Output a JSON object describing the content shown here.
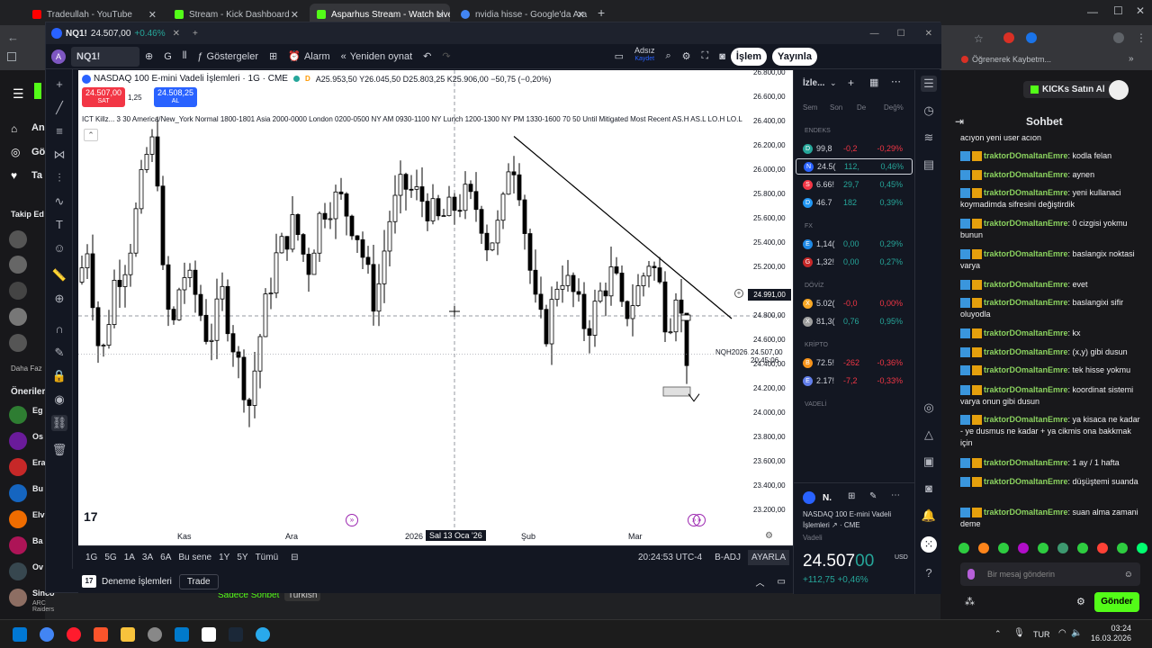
{
  "browser": {
    "tabs": [
      {
        "label": "Tradeullah - YouTube",
        "color": "#ff0000"
      },
      {
        "label": "Stream - Kick Dashboard",
        "color": "#53fc18"
      },
      {
        "label": "Asparhus Stream - Watch Live c",
        "color": "#53fc18"
      },
      {
        "label": "nvidia hisse - Google'da Ara",
        "color": "#4285f4"
      }
    ],
    "bookmark": "Öğrenerek Kaybetm..."
  },
  "tv": {
    "title": {
      "symbol": "NQ1!",
      "price": "24.507,00",
      "change": "+0.46%"
    },
    "toolbar": {
      "symbol": "NQ1!",
      "interval": "G",
      "indicators": "Göstergeler",
      "alarm": "Alarm",
      "replay": "Yeniden oynat",
      "layout_name": "Adsız",
      "layout_save": "Kaydet",
      "trade": "İşlem",
      "publish": "Yayınla"
    },
    "legend": {
      "name": "NASDAQ 100 E-mini Vadeli İşlemleri · 1G · CME",
      "ohlc": "A25.953,50  Y26.045,50  D25.803,25  K25.906,00  −50,75 (−0,20%)",
      "sell_price": "24.507,00",
      "sell_label": "SAT",
      "spread": "1,25",
      "buy_price": "24.508,25",
      "buy_label": "AL",
      "indicator": "ICT Killz... 3 30 America/New_York Normal 1800-1801 Asia 2000-0000 London 0200-0500 NY AM 0930-1100 NY Lunch 1200-1300 NY PM 1330-1600 70 50 Until Mitigated Most Recent AS.H AS.L LO.H LO.L"
    },
    "price_ticks": [
      "26.800,00",
      "26.600,00",
      "26.400,00",
      "26.200,00",
      "26.000,00",
      "25.800,00",
      "25.600,00",
      "25.400,00",
      "25.200,00",
      "24.800,00",
      "24.600,00",
      "24.400,00",
      "24.200,00",
      "24.000,00",
      "23.800,00",
      "23.600,00",
      "23.400,00",
      "23.200,00"
    ],
    "crosshair_price": "24.991,00",
    "last_price": {
      "label": "NQH2026",
      "price": "24.507,00",
      "countdown": "20:45:06"
    },
    "time_ticks": [
      "Kas",
      "Ara",
      "2026",
      "Şub",
      "Mar"
    ],
    "crosshair_date": "Sal 13 Oca '26",
    "bottom": {
      "ranges": [
        "1G",
        "5G",
        "1A",
        "3A",
        "6A",
        "Bu sene",
        "1Y",
        "5Y",
        "Tümü"
      ],
      "clock": "20:24:53 UTC-4",
      "badj": "B-ADJ",
      "settings": "AYARLA"
    },
    "trade_bar": {
      "demo": "Deneme İşlemleri",
      "trade": "Trade"
    },
    "watchlist": {
      "title": "İzle...",
      "columns": [
        "Sem",
        "Son",
        "De",
        "Değ%"
      ],
      "sections": [
        {
          "name": "ENDEKS",
          "rows": [
            {
              "sym": "D",
              "color": "#26a69a",
              "last": "99,8",
              "chg": "-0,2",
              "pct": "-0,29%",
              "dir": "down"
            },
            {
              "sym": "N",
              "color": "#2962ff",
              "last": "24.5(",
              "chg": "112,",
              "pct": "0,46%",
              "dir": "up"
            },
            {
              "sym": "S",
              "color": "#f23645",
              "last": "6.66!",
              "chg": "29,7",
              "pct": "0,45%",
              "dir": "up"
            },
            {
              "sym": "D",
              "color": "#2196f3",
              "last": "46.7",
              "chg": "182",
              "pct": "0,39%",
              "dir": "up"
            }
          ]
        },
        {
          "name": "FX",
          "rows": [
            {
              "sym": "E",
              "color": "#1e88e5",
              "last": "1,14(",
              "chg": "0,00",
              "pct": "0,29%",
              "dir": "up"
            },
            {
              "sym": "G",
              "color": "#c62828",
              "last": "1,32!",
              "chg": "0,00",
              "pct": "0,27%",
              "dir": "up"
            }
          ]
        },
        {
          "name": "DÖVİZ",
          "rows": [
            {
              "sym": "X",
              "color": "#f9a825",
              "last": "5.02(",
              "chg": "-0,0",
              "pct": "0,00%",
              "dir": "down"
            },
            {
              "sym": "X",
              "color": "#9e9e9e",
              "last": "81,3(",
              "chg": "0,76",
              "pct": "0,95%",
              "dir": "up"
            }
          ]
        },
        {
          "name": "KRİPTO",
          "rows": [
            {
              "sym": "B",
              "color": "#f7931a",
              "last": "72.5!",
              "chg": "-262",
              "pct": "-0,36%",
              "dir": "down"
            },
            {
              "sym": "E",
              "color": "#627eea",
              "last": "2.17!",
              "chg": "-7,2",
              "pct": "-0,33%",
              "dir": "down"
            }
          ]
        },
        {
          "name": "VADELİ",
          "rows": []
        }
      ],
      "detail": {
        "symbol": "N.",
        "name1": "NASDAQ 100 E-mini Vadeli",
        "name2": "İşlemleri",
        "exchange": "CME",
        "type": "Vadeli",
        "price_main": "24.507",
        "price_dec": "00",
        "currency": "USD",
        "change": "+112,75",
        "change_pct": "+0,46%"
      }
    }
  },
  "kick": {
    "buy": "KICKs Satın Al",
    "chat_title": "Sohbet",
    "first_line": "acıyon yeni user acıon",
    "messages": [
      {
        "user": "traktorDOmaltanEmre",
        "text": "kodla felan"
      },
      {
        "user": "traktorDOmaltanEmre",
        "text": "aynen"
      },
      {
        "user": "traktorDOmaltanEmre",
        "text": "yeni kullanaci koymadimda sifresini değiştirdik"
      },
      {
        "user": "traktorDOmaltanEmre",
        "text": "0 cizgisi yokmu bunun"
      },
      {
        "user": "traktorDOmaltanEmre",
        "text": "baslangix noktasi varya"
      },
      {
        "user": "traktorDOmaltanEmre",
        "text": "evet"
      },
      {
        "user": "traktorDOmaltanEmre",
        "text": "baslangixi sifir oluyodla"
      },
      {
        "user": "traktorDOmaltanEmre",
        "text": "kx"
      },
      {
        "user": "traktorDOmaltanEmre",
        "text": "(x,y) gibi dusun"
      },
      {
        "user": "traktorDOmaltanEmre",
        "text": "tek hisse yokmu"
      },
      {
        "user": "traktorDOmaltanEmre",
        "text": "koordinat sistemi varya onun gibi dusun"
      },
      {
        "user": "traktorDOmaltanEmre",
        "text": "ya kisaca ne kadar - ye dusmus ne kadar + ya cikmis ona bakkmak için"
      },
      {
        "user": "traktorDOmaltanEmre",
        "text": "1 ay / 1 hafta"
      },
      {
        "user": "traktorDOmaltanEmre",
        "text": "düşüştemi suanda"
      },
      {
        "user": "traktorDOmaltanEmre",
        "text": "suan alma zamani deme"
      }
    ],
    "input_placeholder": "Bir mesaj gönderin",
    "send": "Gönder",
    "left": {
      "labels": [
        "An",
        "Gö",
        "Ta",
        "Takip Ed",
        "Daha Faz",
        "Öneriler"
      ],
      "suggestions": [
        "Eg",
        "Os",
        "Era",
        "Bu",
        "Elv",
        "Ba",
        "Ov",
        "Sinco"
      ],
      "sinco_sub": "ARC Raiders"
    },
    "under_tabs": {
      "a": "Sadece Sohbet",
      "b": "Turkish"
    }
  },
  "taskbar": {
    "lang": "TUR",
    "time": "03:24",
    "date": "16.03.2026"
  }
}
